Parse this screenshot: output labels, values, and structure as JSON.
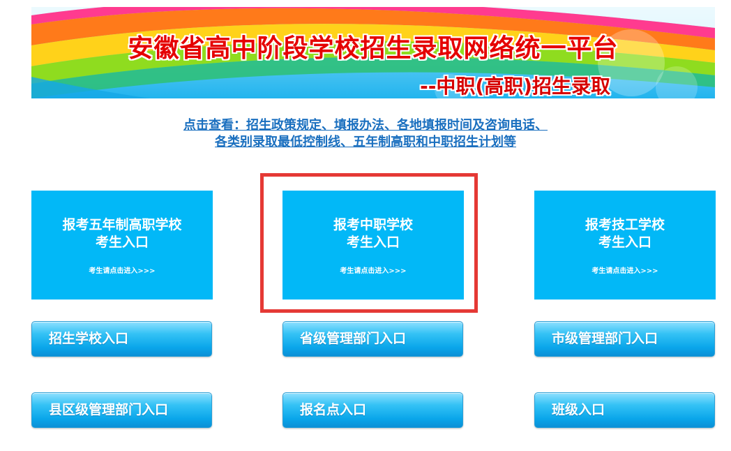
{
  "banner": {
    "title": "安徽省高中阶段学校招生录取网络统一平台",
    "subtitle": "--中职(高职)招生录取"
  },
  "notice": {
    "line1": "点击查看：招生政策规定、填报办法、各地填报时间及咨询电话、",
    "line2": "各类别录取最低控制线、五年制高职和中职招生计划等"
  },
  "entries": [
    {
      "title": "报考五年制高职学校",
      "subtitle": "考生入口",
      "hint": "考生请点击进入>>>"
    },
    {
      "title": "报考中职学校",
      "subtitle": "考生入口",
      "hint": "考生请点击进入>>>"
    },
    {
      "title": "报考技工学校",
      "subtitle": "考生入口",
      "hint": "考生请点击进入>>>"
    }
  ],
  "buttons": {
    "school": "招生学校入口",
    "provincial": "省级管理部门入口",
    "city": "市级管理部门入口",
    "county": "县区级管理部门入口",
    "registration": "报名点入口",
    "class": "班级入口"
  },
  "colors": {
    "card": "#02b8f7",
    "highlight": "#e53935",
    "link": "#1a6fbf",
    "title": "#e50000"
  }
}
